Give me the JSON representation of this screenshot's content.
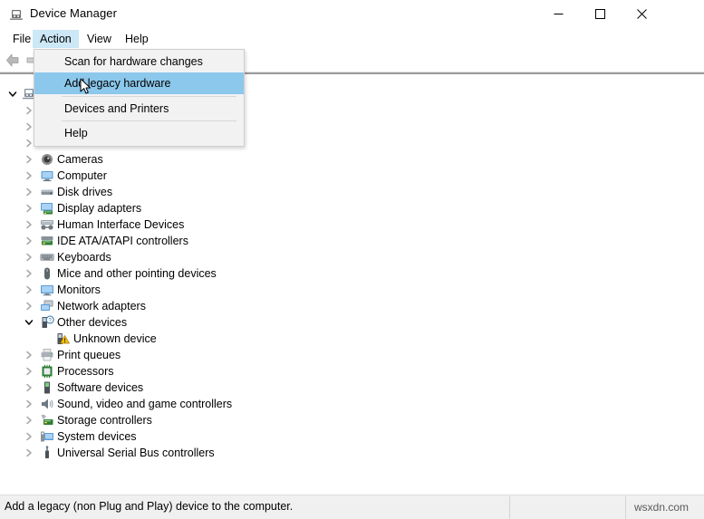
{
  "window": {
    "title": "Device Manager",
    "icon": "device-manager-icon",
    "controls": {
      "minimize": "minimize-icon",
      "maximize": "maximize-icon",
      "close": "close-icon"
    }
  },
  "menubar": {
    "items": [
      {
        "label": "File",
        "active": false
      },
      {
        "label": "Action",
        "active": true
      },
      {
        "label": "View",
        "active": false
      },
      {
        "label": "Help",
        "active": false
      }
    ]
  },
  "toolbar": {
    "back_icon": "back-arrow-icon",
    "forward_icon": "forward-arrow-icon"
  },
  "dropdown": {
    "open_for": "Action",
    "highlight_color": "#8cc8ec",
    "items": [
      {
        "label": "Scan for hardware changes",
        "selected": false,
        "separator_after": false
      },
      {
        "label": "Add legacy hardware",
        "selected": true,
        "separator_after": true
      },
      {
        "label": "Devices and Printers",
        "selected": false,
        "separator_after": true
      },
      {
        "label": "Help",
        "selected": false,
        "separator_after": false
      }
    ]
  },
  "cursor": {
    "type": "arrow-cursor"
  },
  "tree": {
    "root": {
      "label": "",
      "icon": "computer-icon",
      "expanded": true,
      "selected": true
    },
    "nodes": [
      {
        "label": "",
        "icon": "audio-icon",
        "expanded": false,
        "depth": 1,
        "hidden_by_menu": true
      },
      {
        "label": "",
        "icon": "battery-icon",
        "expanded": false,
        "depth": 1,
        "hidden_by_menu": true
      },
      {
        "label": "",
        "icon": "bluetooth-icon",
        "expanded": false,
        "depth": 1,
        "hidden_by_menu": true
      },
      {
        "label": "Cameras",
        "icon": "camera-icon",
        "expanded": false,
        "depth": 1,
        "hidden_by_menu": false
      },
      {
        "label": "Computer",
        "icon": "computer-icon",
        "expanded": false,
        "depth": 1,
        "hidden_by_menu": false
      },
      {
        "label": "Disk drives",
        "icon": "disk-icon",
        "expanded": false,
        "depth": 1,
        "hidden_by_menu": false
      },
      {
        "label": "Display adapters",
        "icon": "display-icon",
        "expanded": false,
        "depth": 1,
        "hidden_by_menu": false
      },
      {
        "label": "Human Interface Devices",
        "icon": "hid-icon",
        "expanded": false,
        "depth": 1,
        "hidden_by_menu": false
      },
      {
        "label": "IDE ATA/ATAPI controllers",
        "icon": "ide-icon",
        "expanded": false,
        "depth": 1,
        "hidden_by_menu": false
      },
      {
        "label": "Keyboards",
        "icon": "keyboard-icon",
        "expanded": false,
        "depth": 1,
        "hidden_by_menu": false
      },
      {
        "label": "Mice and other pointing devices",
        "icon": "mouse-icon",
        "expanded": false,
        "depth": 1,
        "hidden_by_menu": false
      },
      {
        "label": "Monitors",
        "icon": "monitor-icon",
        "expanded": false,
        "depth": 1,
        "hidden_by_menu": false
      },
      {
        "label": "Network adapters",
        "icon": "network-icon",
        "expanded": false,
        "depth": 1,
        "hidden_by_menu": false
      },
      {
        "label": "Other devices",
        "icon": "unknown-icon",
        "expanded": true,
        "depth": 1,
        "hidden_by_menu": false
      },
      {
        "label": "Unknown device",
        "icon": "warning-device-icon",
        "expanded": null,
        "depth": 2,
        "hidden_by_menu": false
      },
      {
        "label": "Print queues",
        "icon": "printer-icon",
        "expanded": false,
        "depth": 1,
        "hidden_by_menu": false
      },
      {
        "label": "Processors",
        "icon": "processor-icon",
        "expanded": false,
        "depth": 1,
        "hidden_by_menu": false
      },
      {
        "label": "Software devices",
        "icon": "software-icon",
        "expanded": false,
        "depth": 1,
        "hidden_by_menu": false
      },
      {
        "label": "Sound, video and game controllers",
        "icon": "sound-icon",
        "expanded": false,
        "depth": 1,
        "hidden_by_menu": false
      },
      {
        "label": "Storage controllers",
        "icon": "storage-icon",
        "expanded": false,
        "depth": 1,
        "hidden_by_menu": false
      },
      {
        "label": "System devices",
        "icon": "system-icon",
        "expanded": false,
        "depth": 1,
        "hidden_by_menu": false
      },
      {
        "label": "Universal Serial Bus controllers",
        "icon": "usb-icon",
        "expanded": false,
        "depth": 1,
        "hidden_by_menu": false
      }
    ]
  },
  "statusbar": {
    "message": "Add a legacy (non Plug and Play) device to the computer.",
    "watermark": "wsxdn.com"
  }
}
